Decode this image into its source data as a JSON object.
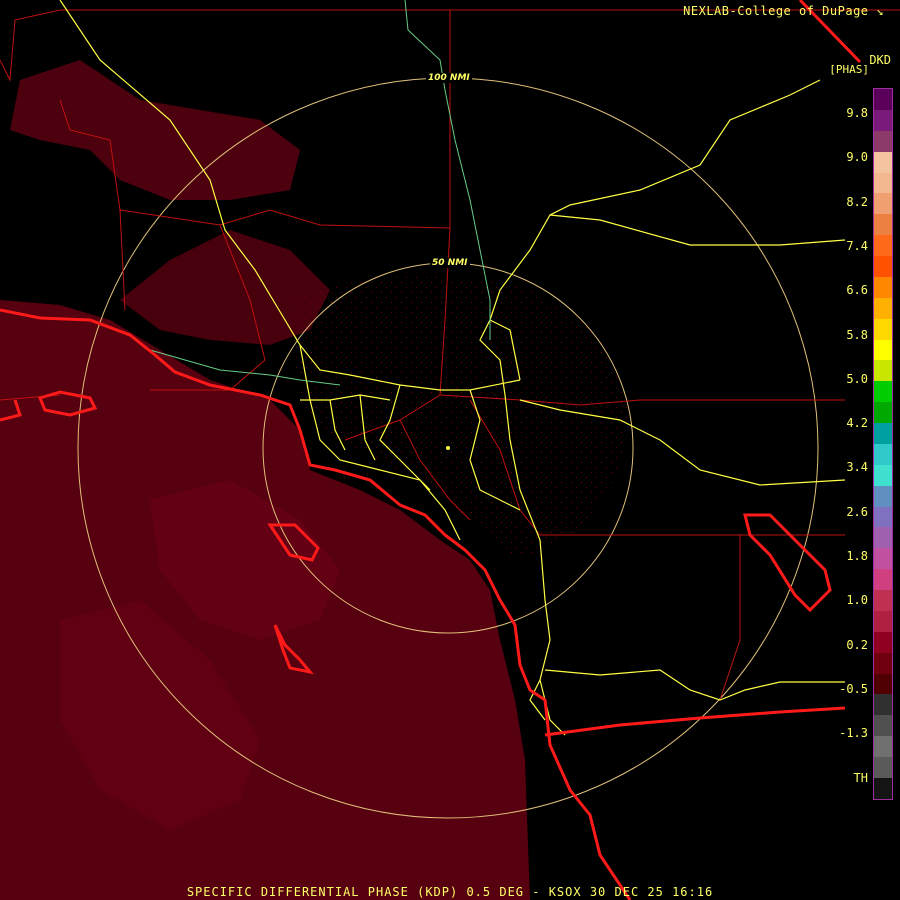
{
  "header": {
    "credit": "NEXLAB-College of DuPage",
    "credit_icon": "arrow-corner-icon",
    "product": "DKD",
    "units": "[PHAS]"
  },
  "rings": {
    "inner_label": "50 NMI",
    "outer_label": "100 NMI"
  },
  "legend": {
    "ticks": [
      "9.8",
      "9.0",
      "8.2",
      "7.4",
      "6.6",
      "5.8",
      "5.0",
      "4.2",
      "3.4",
      "2.6",
      "1.8",
      "1.0",
      "0.2",
      "-0.5",
      "-1.3",
      "TH"
    ],
    "colors": [
      "#5a005a",
      "#7a1a7a",
      "#8c3a6a",
      "#f4c4a0",
      "#f4b890",
      "#f0a070",
      "#ec8040",
      "#ff6a1a",
      "#ff5200",
      "#ff8800",
      "#ffb000",
      "#ffd800",
      "#ffff00",
      "#c8e600",
      "#00cc00",
      "#00a800",
      "#00a0a0",
      "#30c8c8",
      "#40e0d0",
      "#6090c0",
      "#8070c0",
      "#a060b0",
      "#c050a0",
      "#d04080",
      "#c03050",
      "#b02040",
      "#900020",
      "#700010",
      "#500000",
      "#303030",
      "#505050",
      "#707070",
      "#5a5a5a",
      "#141414"
    ]
  },
  "footer": {
    "title": "SPECIFIC DIFFERENTIAL PHASE (KDP) 0.5 DEG - KSOX 30 DEC 25 16:16"
  }
}
